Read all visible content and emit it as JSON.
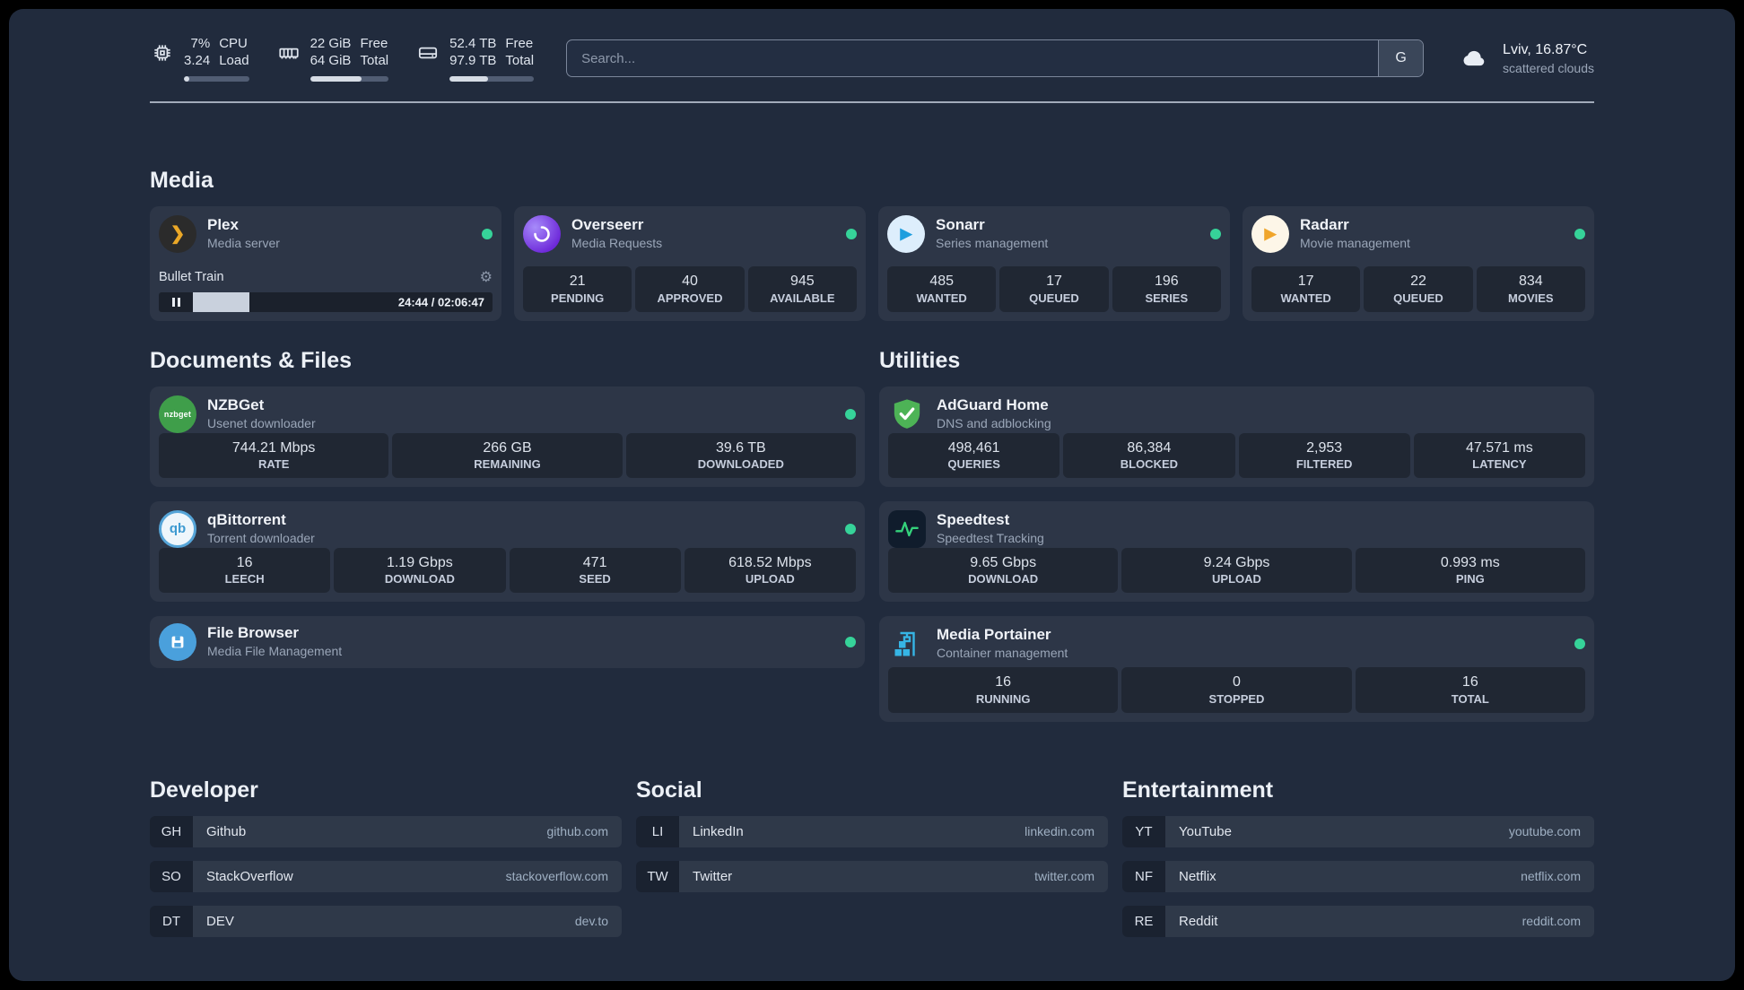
{
  "topbar": {
    "cpu": {
      "percent": "7%",
      "load": "3.24",
      "percent_label": "CPU",
      "load_label": "Load",
      "progress": 8
    },
    "memory": {
      "free": "22 GiB",
      "total": "64 GiB",
      "free_label": "Free",
      "total_label": "Total",
      "progress": 66
    },
    "disk": {
      "free": "52.4 TB",
      "total": "97.9 TB",
      "free_label": "Free",
      "total_label": "Total",
      "progress": 46
    },
    "search": {
      "placeholder": "Search...",
      "button_label": "G"
    },
    "weather": {
      "location": "Lviv, 16.87°C",
      "condition": "scattered clouds"
    }
  },
  "media": {
    "title": "Media",
    "plex": {
      "name": "Plex",
      "subtitle": "Media server",
      "now_playing": "Bullet Train",
      "time": "24:44 / 02:06:47",
      "progress": 19
    },
    "overseerr": {
      "name": "Overseerr",
      "subtitle": "Media Requests",
      "stats": [
        {
          "value": "21",
          "label": "PENDING"
        },
        {
          "value": "40",
          "label": "APPROVED"
        },
        {
          "value": "945",
          "label": "AVAILABLE"
        }
      ]
    },
    "sonarr": {
      "name": "Sonarr",
      "subtitle": "Series management",
      "stats": [
        {
          "value": "485",
          "label": "WANTED"
        },
        {
          "value": "17",
          "label": "QUEUED"
        },
        {
          "value": "196",
          "label": "SERIES"
        }
      ]
    },
    "radarr": {
      "name": "Radarr",
      "subtitle": "Movie management",
      "stats": [
        {
          "value": "17",
          "label": "WANTED"
        },
        {
          "value": "22",
          "label": "QUEUED"
        },
        {
          "value": "834",
          "label": "MOVIES"
        }
      ]
    }
  },
  "documents": {
    "title": "Documents & Files",
    "nzbget": {
      "name": "NZBGet",
      "subtitle": "Usenet downloader",
      "stats": [
        {
          "value": "744.21 Mbps",
          "label": "RATE"
        },
        {
          "value": "266 GB",
          "label": "REMAINING"
        },
        {
          "value": "39.6 TB",
          "label": "DOWNLOADED"
        }
      ]
    },
    "qbittorrent": {
      "name": "qBittorrent",
      "subtitle": "Torrent downloader",
      "stats": [
        {
          "value": "16",
          "label": "LEECH"
        },
        {
          "value": "1.19 Gbps",
          "label": "DOWNLOAD"
        },
        {
          "value": "471",
          "label": "SEED"
        },
        {
          "value": "618.52 Mbps",
          "label": "UPLOAD"
        }
      ]
    },
    "filebrowser": {
      "name": "File Browser",
      "subtitle": "Media File Management"
    }
  },
  "utilities": {
    "title": "Utilities",
    "adguard": {
      "name": "AdGuard Home",
      "subtitle": "DNS and adblocking",
      "stats": [
        {
          "value": "498,461",
          "label": "QUERIES"
        },
        {
          "value": "86,384",
          "label": "BLOCKED"
        },
        {
          "value": "2,953",
          "label": "FILTERED"
        },
        {
          "value": "47.571 ms",
          "label": "LATENCY"
        }
      ]
    },
    "speedtest": {
      "name": "Speedtest",
      "subtitle": "Speedtest Tracking",
      "stats": [
        {
          "value": "9.65 Gbps",
          "label": "DOWNLOAD"
        },
        {
          "value": "9.24 Gbps",
          "label": "UPLOAD"
        },
        {
          "value": "0.993 ms",
          "label": "PING"
        }
      ]
    },
    "portainer": {
      "name": "Media Portainer",
      "subtitle": "Container management",
      "stats": [
        {
          "value": "16",
          "label": "RUNNING"
        },
        {
          "value": "0",
          "label": "STOPPED"
        },
        {
          "value": "16",
          "label": "TOTAL"
        }
      ]
    }
  },
  "bookmarks": {
    "developer": {
      "title": "Developer",
      "items": [
        {
          "abbr": "GH",
          "name": "Github",
          "url": "github.com"
        },
        {
          "abbr": "SO",
          "name": "StackOverflow",
          "url": "stackoverflow.com"
        },
        {
          "abbr": "DT",
          "name": "DEV",
          "url": "dev.to"
        }
      ]
    },
    "social": {
      "title": "Social",
      "items": [
        {
          "abbr": "LI",
          "name": "LinkedIn",
          "url": "linkedin.com"
        },
        {
          "abbr": "TW",
          "name": "Twitter",
          "url": "twitter.com"
        }
      ]
    },
    "entertainment": {
      "title": "Entertainment",
      "items": [
        {
          "abbr": "YT",
          "name": "YouTube",
          "url": "youtube.com"
        },
        {
          "abbr": "NF",
          "name": "Netflix",
          "url": "netflix.com"
        },
        {
          "abbr": "RE",
          "name": "Reddit",
          "url": "reddit.com"
        }
      ]
    }
  },
  "icons": {
    "plex_glyph": "❯",
    "sonarr_glyph": "▶",
    "radarr_glyph": "▶",
    "gear_glyph": "⚙",
    "nzbget_text": "nzbget",
    "qbittorrent_text": "qb"
  }
}
